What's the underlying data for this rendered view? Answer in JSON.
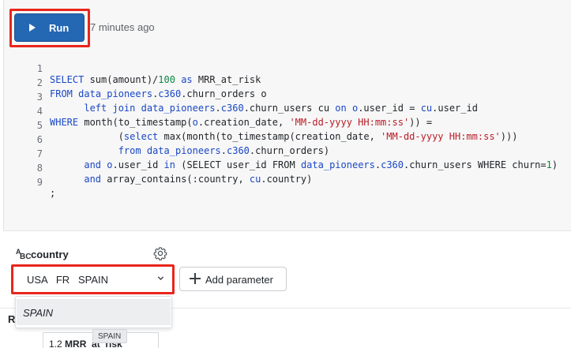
{
  "toolbar": {
    "run_label": "Run",
    "last_run": "7 minutes ago"
  },
  "editor": {
    "line_numbers": [
      "1",
      "2",
      "3",
      "4",
      "5",
      "6",
      "7",
      "8",
      "9"
    ],
    "lines": [
      "SELECT sum(amount)/100 as MRR_at_risk",
      "FROM data_pioneers.c360.churn_orders o",
      "      left join data_pioneers.c360.churn_users cu on o.user_id = cu.user_id",
      "WHERE month(to_timestamp(o.creation_date, 'MM-dd-yyyy HH:mm:ss')) =",
      "            (select max(month(to_timestamp(creation_date, 'MM-dd-yyyy HH:mm:ss')))",
      "            from data_pioneers.c360.churn_orders)",
      "      and o.user_id in (SELECT user_id FROM data_pioneers.c360.churn_users WHERE churn=1)",
      "      and array_contains(:country, cu.country)",
      ";"
    ]
  },
  "parameter": {
    "icon_glyph_top": "A",
    "icon_glyph_bottom": "BC",
    "name": "country",
    "selected_values": [
      "USA",
      "FR",
      "SPAIN"
    ],
    "selected_display": "USA   FR   SPAIN",
    "dropdown_option": "SPAIN",
    "tooltip": "SPAIN"
  },
  "add_parameter_label": "Add parameter",
  "results": {
    "tab_label": "R",
    "column_header_type": "1.2",
    "column_header_name": "MRR_at_risk"
  },
  "colors": {
    "run_button": "#2467b3",
    "highlight": "#e8261c",
    "keyword": "#1a47c5",
    "string": "#b91d26",
    "number": "#0c8545"
  }
}
